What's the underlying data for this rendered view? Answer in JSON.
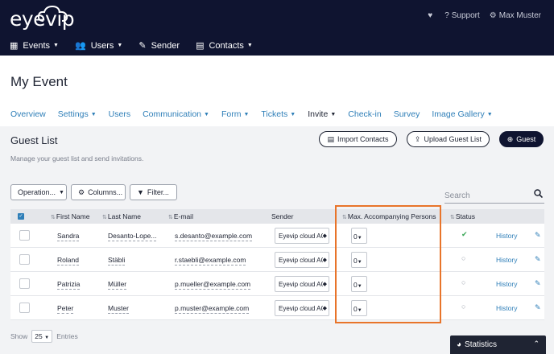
{
  "app": {
    "logo": "eyevip"
  },
  "top_right": {
    "support": "Support",
    "user": "Max Muster"
  },
  "main_nav": [
    {
      "label": "Events",
      "icon": "calendar-icon",
      "has_caret": true
    },
    {
      "label": "Users",
      "icon": "users-icon",
      "has_caret": true
    },
    {
      "label": "Sender",
      "icon": "edit-icon",
      "has_caret": false
    },
    {
      "label": "Contacts",
      "icon": "id-card-icon",
      "has_caret": true
    }
  ],
  "page": {
    "title": "My Event"
  },
  "tabs": [
    {
      "label": "Overview",
      "caret": false,
      "active": false
    },
    {
      "label": "Settings",
      "caret": true,
      "active": false
    },
    {
      "label": "Users",
      "caret": false,
      "active": false
    },
    {
      "label": "Communication",
      "caret": true,
      "active": false
    },
    {
      "label": "Form",
      "caret": true,
      "active": false
    },
    {
      "label": "Tickets",
      "caret": true,
      "active": false
    },
    {
      "label": "Invite",
      "caret": true,
      "active": true
    },
    {
      "label": "Check-in",
      "caret": false,
      "active": false
    },
    {
      "label": "Survey",
      "caret": false,
      "active": false
    },
    {
      "label": "Image Gallery",
      "caret": true,
      "active": false
    }
  ],
  "guest_list": {
    "title": "Guest List",
    "subtitle": "Manage your guest list and send invitations.",
    "import_label": "Import Contacts",
    "upload_label": "Upload Guest List",
    "guest_label": "Guest",
    "operation_label": "Operation...",
    "columns_label": "Columns...",
    "filter_label": "Filter...",
    "search_placeholder": "Search"
  },
  "table": {
    "headers": {
      "first_name": "First Name",
      "last_name": "Last Name",
      "email": "E-mail",
      "sender": "Sender",
      "max_acc": "Max. Accompanying Persons",
      "status": "Status"
    },
    "rows": [
      {
        "first": "Sandra",
        "last": "Desanto-Lope...",
        "email": "s.desanto@example.com",
        "sender": "Eyevip cloud AG",
        "acc": "0",
        "status": "confirmed",
        "history": "History"
      },
      {
        "first": "Roland",
        "last": "Stäbli",
        "email": "r.staebli@example.com",
        "sender": "Eyevip cloud AG",
        "acc": "0",
        "status": "open",
        "history": "History"
      },
      {
        "first": "Patrizia",
        "last": "Müller",
        "email": "p.mueller@example.com",
        "sender": "Eyevip cloud AG",
        "acc": "0",
        "status": "open",
        "history": "History"
      },
      {
        "first": "Peter",
        "last": "Muster",
        "email": "p.muster@example.com",
        "sender": "Eyevip cloud AG",
        "acc": "0",
        "status": "open",
        "history": "History"
      }
    ]
  },
  "footer": {
    "show": "Show",
    "page_size": "25",
    "entries": "Entries"
  },
  "stats": {
    "label": "Statistics"
  },
  "colors": {
    "topbar": "#0f1430",
    "accent": "#2f7fb8",
    "highlight": "#e8742a",
    "confirmed": "#3aa757"
  }
}
